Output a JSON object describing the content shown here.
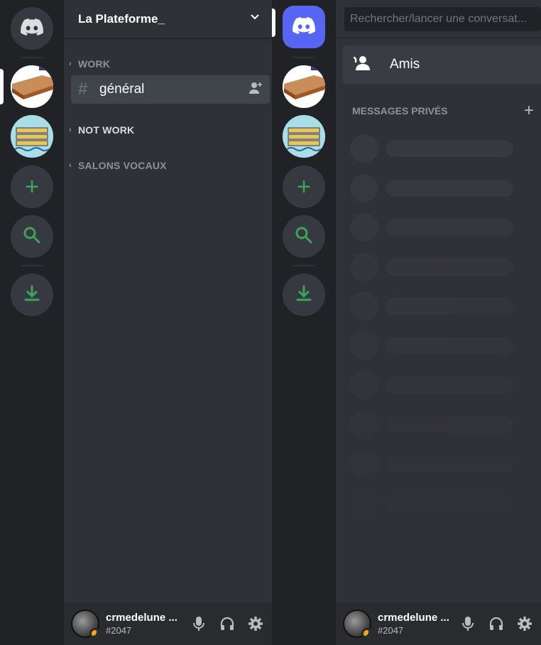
{
  "left": {
    "guild_name": "La Plateforme_",
    "categories": [
      {
        "label": "WORK"
      },
      {
        "label": "NOT WORK"
      },
      {
        "label": "SALONS VOCAUX"
      }
    ],
    "channel": {
      "name": "général",
      "prefix": "#"
    }
  },
  "right": {
    "search_placeholder": "Rechercher/lancer une conversat...",
    "friends_label": "Amis",
    "dm_header": "MESSAGES PRIVÉS",
    "dm_add": "+",
    "placeholder_rows": 10
  },
  "user": {
    "name": "crmedelune ...",
    "tag": "#2047",
    "status": "idle"
  },
  "rail": {
    "add_glyph": "+",
    "icons": [
      "discord-home-icon",
      "server-wood-board-icon",
      "server-racks-icon",
      "add-server-icon",
      "explore-search-icon",
      "download-apps-icon"
    ]
  },
  "colors": {
    "rail_bg": "#202225",
    "panel_bg": "#2f3136",
    "accent_blurple": "#5865f2",
    "green": "#3ba55c",
    "idle": "#faa61a"
  }
}
